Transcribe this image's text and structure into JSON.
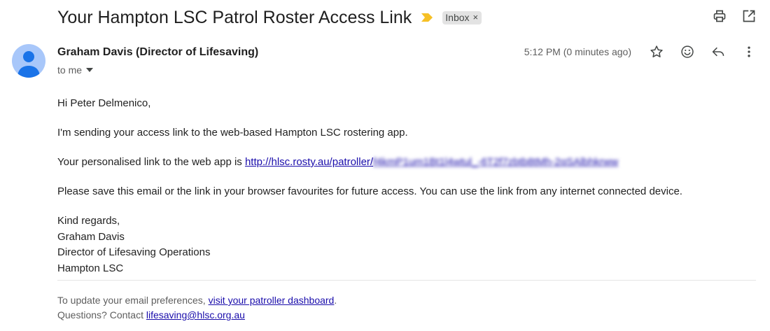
{
  "email": {
    "subject": "Your Hampton LSC Patrol Roster Access Link",
    "label": "Inbox",
    "label_remove": "×",
    "sender": "Graham Davis (Director of Lifesaving)",
    "to": "to me",
    "timestamp": "5:12 PM (0 minutes ago)"
  },
  "body": {
    "greeting": "Hi Peter Delmenico,",
    "intro": "I'm sending your access link to the web-based Hampton LSC rostering app.",
    "link_prefix": "Your personalised link to the web app is ",
    "link_visible": "http://hlsc.rosty.au/patroller/",
    "link_obscured": "f4kmP1um1Bt1l4wtul_-6T2f7zbtb8tMh-2qSAlbhkrww",
    "save_note": "Please save this email or the link in your browser favourites for future access. You can use the link from any internet connected device.",
    "closing": "Kind regards,",
    "sig_name": "Graham Davis",
    "sig_title": "Director of Lifesaving Operations",
    "sig_org": "Hampton LSC"
  },
  "footer": {
    "prefs_prefix": "To update your email preferences, ",
    "prefs_link": "visit your patroller dashboard",
    "prefs_suffix": ".",
    "questions_prefix": "Questions? Contact ",
    "contact_email": "lifesaving@hlsc.org.au"
  },
  "icons": [
    "importance-marker-icon",
    "print-icon",
    "open-in-new-window-icon",
    "star-icon",
    "emoji-react-icon",
    "reply-icon",
    "more-vert-icon",
    "chevron-down-icon",
    "avatar-person-icon"
  ],
  "colors": {
    "link": "#1a0dab",
    "importance": "#f6c026",
    "avatar_bg": "#a8c7fa",
    "avatar_fg": "#1a73e8",
    "chip_bg": "#e3e3e3"
  }
}
